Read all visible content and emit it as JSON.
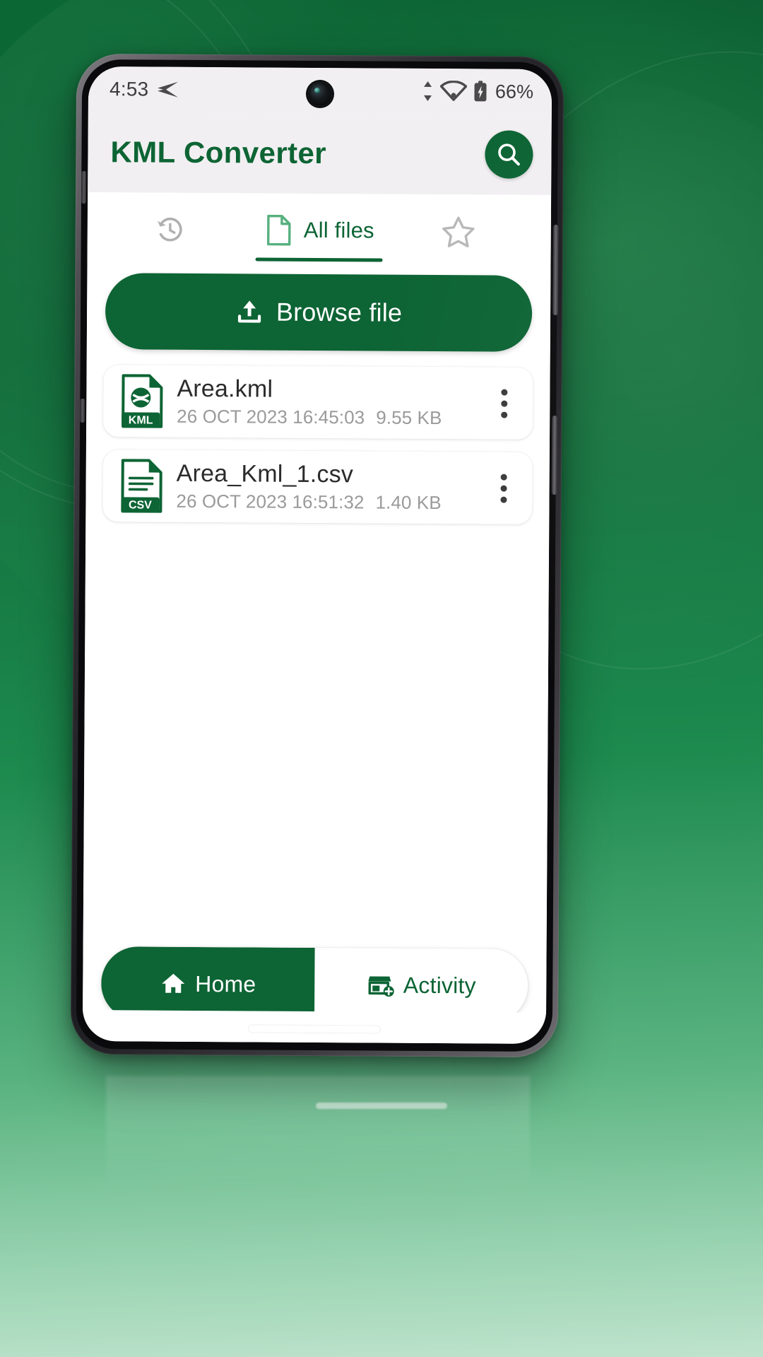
{
  "theme": {
    "brand_green": "#0d6434",
    "status_bar_bg": "#f1eff1",
    "app_bar_bg": "#f1eff1",
    "sheet_bg": "#ffffff",
    "muted_text": "#9a9a9a",
    "primary_text": "#2b2b2b"
  },
  "status_bar": {
    "time": "4:53",
    "left_icons": [
      "send-plane-icon"
    ],
    "right_icons": [
      "data-transfer-icon",
      "wifi-icon",
      "battery-charging-icon"
    ],
    "battery_percent": "66%"
  },
  "app_bar": {
    "title": "KML Converter",
    "search_icon": "search-icon"
  },
  "tabs": [
    {
      "id": "recent",
      "label": "",
      "icon": "history-clock-icon",
      "active": false
    },
    {
      "id": "all-files",
      "label": "All files",
      "icon": "file-document-icon",
      "active": true
    },
    {
      "id": "favorites",
      "label": "",
      "icon": "star-outline-icon",
      "active": false
    }
  ],
  "browse": {
    "label": "Browse file",
    "icon": "upload-icon"
  },
  "files": {
    "columns": [
      "name",
      "date",
      "size"
    ],
    "rows": [
      {
        "name": "Area.kml",
        "date": "26 OCT 2023 16:45:03",
        "size": "9.55 KB",
        "type": "KML",
        "icon": "kml-file-icon",
        "badge": "KML",
        "menu_icon": "kebab-menu-icon"
      },
      {
        "name": "Area_Kml_1.csv",
        "date": "26 OCT 2023 16:51:32",
        "size": "1.40 KB",
        "type": "CSV",
        "icon": "csv-file-icon",
        "badge": "CSV",
        "menu_icon": "kebab-menu-icon"
      }
    ]
  },
  "bottom_nav": [
    {
      "id": "home",
      "label": "Home",
      "icon": "home-icon",
      "active": true
    },
    {
      "id": "activity",
      "label": "Activity",
      "icon": "store-add-icon",
      "active": false
    }
  ]
}
